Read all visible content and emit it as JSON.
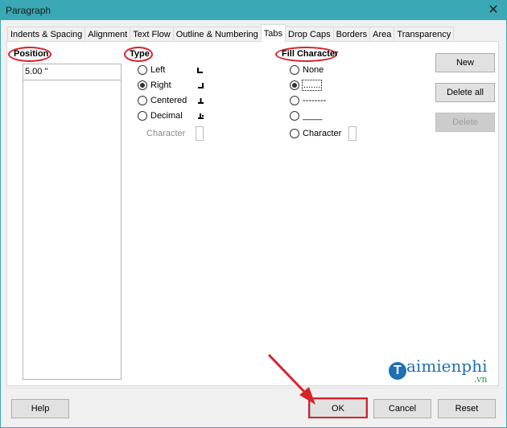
{
  "window": {
    "title": "Paragraph",
    "close_icon": "close-icon"
  },
  "tabs": [
    {
      "label": "Indents & Spacing",
      "active": false
    },
    {
      "label": "Alignment",
      "active": false
    },
    {
      "label": "Text Flow",
      "active": false
    },
    {
      "label": "Outline & Numbering",
      "active": false
    },
    {
      "label": "Tabs",
      "active": true
    },
    {
      "label": "Drop Caps",
      "active": false
    },
    {
      "label": "Borders",
      "active": false
    },
    {
      "label": "Area",
      "active": false
    },
    {
      "label": "Transparency",
      "active": false
    }
  ],
  "position": {
    "heading": "Position",
    "value": "5.00 \"",
    "list_items": []
  },
  "type": {
    "heading": "Type",
    "options": [
      {
        "label": "Left",
        "checked": false,
        "icon": "tab-left-icon"
      },
      {
        "label": "Right",
        "checked": true,
        "icon": "tab-right-icon"
      },
      {
        "label": "Centered",
        "checked": false,
        "icon": "tab-center-icon"
      },
      {
        "label": "Decimal",
        "checked": false,
        "icon": "tab-decimal-icon"
      }
    ],
    "character_label": "Character",
    "character_value": ""
  },
  "fill": {
    "heading": "Fill Character",
    "options": [
      {
        "label": "None",
        "checked": false
      },
      {
        "label": ".......",
        "checked": true
      },
      {
        "label": "--------",
        "checked": false
      },
      {
        "label": "____",
        "checked": false
      },
      {
        "label": "Character",
        "checked": false
      }
    ],
    "character_value": ""
  },
  "side_buttons": {
    "new": "New",
    "delete_all": "Delete all",
    "delete": "Delete"
  },
  "footer": {
    "help": "Help",
    "ok": "OK",
    "cancel": "Cancel",
    "reset": "Reset"
  },
  "watermark": {
    "main": "aimienphi",
    "initial": "T",
    "sub": ".vn"
  },
  "colors": {
    "titlebar": "#3aa9b5",
    "annotation": "#d4232b"
  }
}
